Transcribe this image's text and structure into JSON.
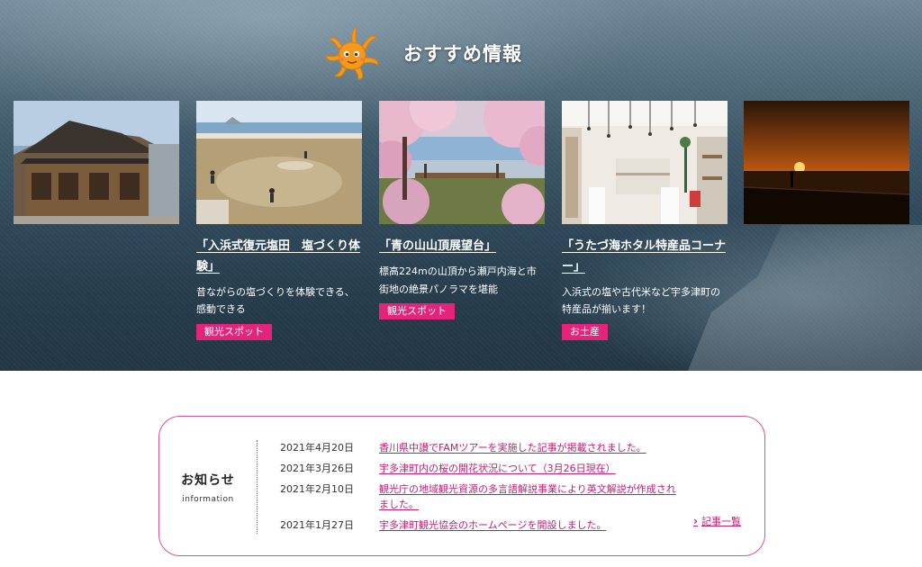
{
  "recommend": {
    "heading": "おすすめ情報",
    "cards": [
      {
        "title": "",
        "desc": "",
        "tag": ""
      },
      {
        "title": "「入浜式復元塩田　塩づくり体験」",
        "desc": "昔ながらの塩づくりを体験できる、感動できる",
        "tag": "観光スポット"
      },
      {
        "title": "「青の山山頂展望台」",
        "desc": "標高224mの山頂から瀬戸内海と市街地の絶景パノラマを堪能",
        "tag": "観光スポット"
      },
      {
        "title": "「うたづ海ホタル特産品コーナー」",
        "desc": "入浜式の塩や古代米など宇多津町の特産品が揃います！",
        "tag": "お土産"
      },
      {
        "title": "",
        "desc": "",
        "tag": ""
      }
    ]
  },
  "news": {
    "title": "お知らせ",
    "subtitle": "information",
    "items": [
      {
        "date": "2021年4月20日",
        "text": "香川県中讃でFAMツアーを実施した記事が掲載されました。"
      },
      {
        "date": "2021年3月26日",
        "text": "宇多津町内の桜の開花状況について（3月26日現在）"
      },
      {
        "date": "2021年2月10日",
        "text": "観光庁の地域観光資源の多言語解説事業により英文解説が作成されました。"
      },
      {
        "date": "2021年1月27日",
        "text": "宇多津町観光協会のホームページを開設しました。"
      }
    ],
    "more_label": "記事一覧"
  },
  "colors": {
    "accent": "#e4247c",
    "link": "#c21d73",
    "border": "#e04f95"
  }
}
